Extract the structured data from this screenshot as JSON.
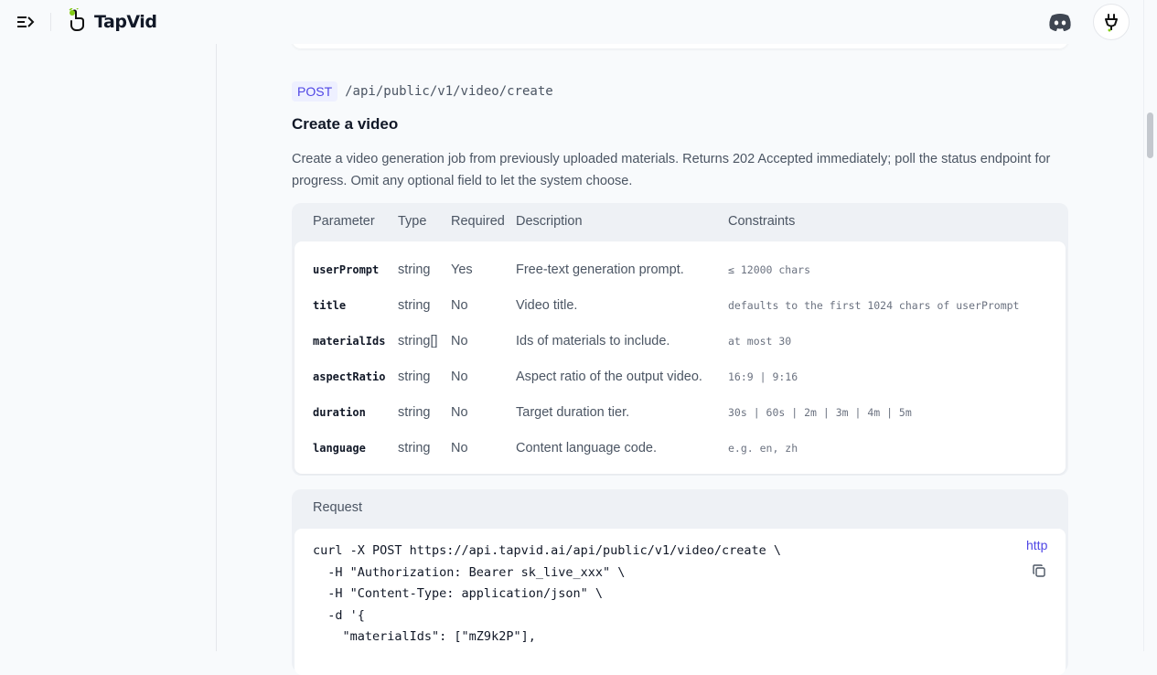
{
  "brand": {
    "name": "TapVid"
  },
  "icons": {
    "menu": "menu-collapse-icon",
    "discord": "discord-icon",
    "avatar": "user-avatar-icon",
    "copy": "copy-icon",
    "logo": "tapvid-logo-icon"
  },
  "endpoint": {
    "method": "POST",
    "path": "/api/public/v1/video/create",
    "title": "Create a video",
    "description": "Create a video generation job from previously uploaded materials. Returns 202 Accepted immediately; poll the status endpoint for progress. Omit any optional field to let the system choose."
  },
  "params": {
    "headers": {
      "parameter": "Parameter",
      "type": "Type",
      "required": "Required",
      "description": "Description",
      "constraints": "Constraints"
    },
    "rows": [
      {
        "name": "userPrompt",
        "type": "string",
        "required": "Yes",
        "description": "Free-text generation prompt.",
        "constraints": "≤ 12000 chars"
      },
      {
        "name": "title",
        "type": "string",
        "required": "No",
        "description": "Video title.",
        "constraints": "defaults to the first 1024 chars of userPrompt"
      },
      {
        "name": "materialIds",
        "type": "string[]",
        "required": "No",
        "description": "Ids of materials to include.",
        "constraints": "at most 30"
      },
      {
        "name": "aspectRatio",
        "type": "string",
        "required": "No",
        "description": "Aspect ratio of the output video.",
        "constraints": "16:9 | 9:16"
      },
      {
        "name": "duration",
        "type": "string",
        "required": "No",
        "description": "Target duration tier.",
        "constraints": "30s | 60s | 2m | 3m | 4m | 5m"
      },
      {
        "name": "language",
        "type": "string",
        "required": "No",
        "description": "Content language code.",
        "constraints": "e.g. en, zh"
      }
    ]
  },
  "request": {
    "heading": "Request",
    "lang": "http",
    "code": "curl -X POST https://api.tapvid.ai/api/public/v1/video/create \\\n  -H \"Authorization: Bearer sk_live_xxx\" \\\n  -H \"Content-Type: application/json\" \\\n  -d '{\n    \"materialIds\": [\"mZ9k2P\"],"
  },
  "colors": {
    "accent": "#4f46e5",
    "badge_bg": "#eef0ff",
    "logo_green": "#84cc16"
  }
}
